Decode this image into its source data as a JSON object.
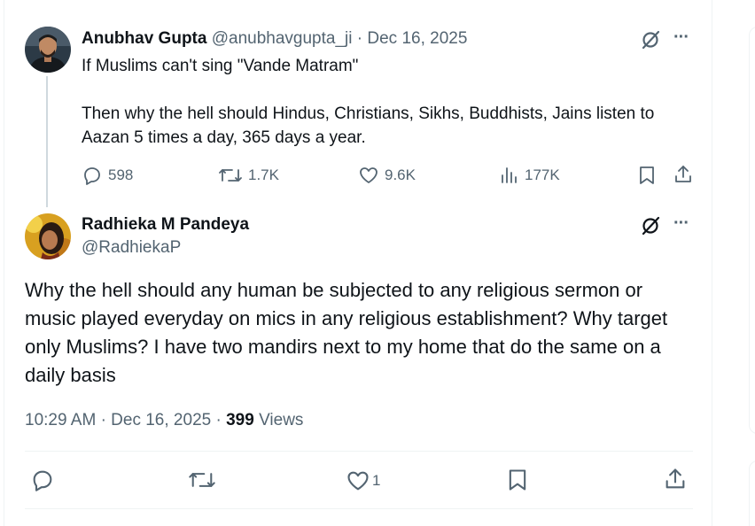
{
  "parent_post": {
    "author_name": "Anubhav Gupta",
    "author_handle": "@anubhavgupta_ji",
    "separator": "·",
    "date": "Dec 16, 2025",
    "body_line1": "If Muslims can't sing \"Vande Matram\"",
    "body_line2": "Then why the hell should Hindus, Christians, Sikhs, Buddhists, Jains listen to Aazan 5 times a day, 365 days a year.",
    "replies": "598",
    "reposts": "1.7K",
    "likes": "9.6K",
    "views": "177K",
    "more": "···"
  },
  "main_post": {
    "author_name": "Radhieka M Pandeya",
    "author_handle": "@RadhiekaP",
    "body": "Why the hell should any human be subjected to any religious sermon or music played everyday on mics in any religious establishment? Why target only Muslims? I have two mandirs next to my home that do the same on a daily basis",
    "time": "10:29 AM",
    "separator": "·",
    "date": "Dec 16, 2025",
    "views_count": "399",
    "views_label": "Views",
    "likes": "1",
    "more": "···"
  },
  "colors": {
    "text": "#0f1419",
    "muted": "#536471",
    "border": "#eff3f4",
    "thread_line": "#cfd9de"
  },
  "icons": {
    "grok": "grok-icon",
    "more": "more-icon",
    "reply": "reply-icon",
    "repost": "repost-icon",
    "like": "like-icon",
    "views": "views-icon",
    "bookmark": "bookmark-icon",
    "share": "share-icon"
  }
}
